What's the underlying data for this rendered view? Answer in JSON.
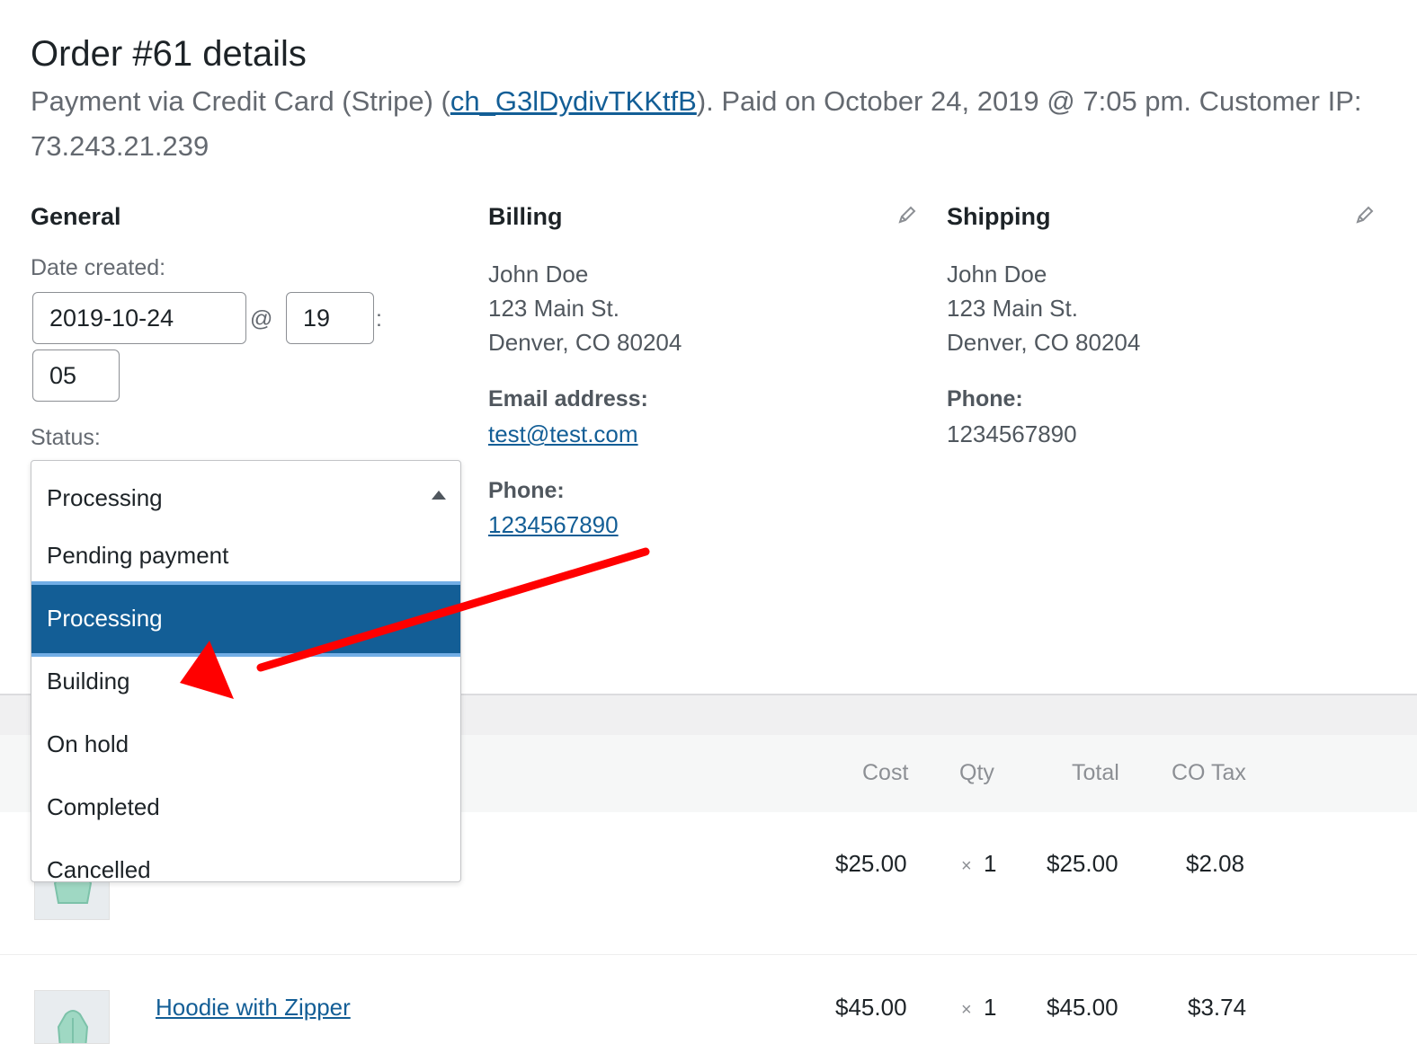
{
  "header": {
    "title": "Order #61 details",
    "meta_prefix": "Payment via Credit Card (Stripe) (",
    "charge_id": "ch_G3lDydivTKKtfB",
    "meta_suffix": "). Paid on October 24, 2019 @ 7:05 pm. Customer IP: 73.243.21.239"
  },
  "general": {
    "heading": "General",
    "date_label": "Date created:",
    "date_value": "2019-10-24",
    "at_sep": "@",
    "hour_value": "19",
    "colon_sep": ":",
    "minute_value": "05",
    "status_label": "Status:",
    "status_selected": "Processing",
    "status_options": [
      "Pending payment",
      "Processing",
      "Building",
      "On hold",
      "Completed",
      "Cancelled"
    ]
  },
  "billing": {
    "heading": "Billing",
    "name": "John Doe",
    "street": "123 Main St.",
    "city": "Denver, CO 80204",
    "email_label": "Email address:",
    "email": "test@test.com",
    "phone_label": "Phone:",
    "phone": "1234567890",
    "edit_icon": "pencil-icon"
  },
  "shipping": {
    "heading": "Shipping",
    "name": "John Doe",
    "street": "123 Main St.",
    "city": "Denver, CO 80204",
    "phone_label": "Phone:",
    "phone": "1234567890",
    "edit_icon": "pencil-icon"
  },
  "items": {
    "columns": [
      "Cost",
      "Qty",
      "Total",
      "CO Tax"
    ],
    "qty_prefix": "×",
    "rows": [
      {
        "name": "",
        "cost": "$25.00",
        "qty": "1",
        "total": "$25.00",
        "tax": "$2.08"
      },
      {
        "name": "Hoodie with Zipper",
        "cost": "$45.00",
        "qty": "1",
        "total": "$45.00",
        "tax": "$3.74"
      }
    ]
  },
  "colors": {
    "link": "#135e96",
    "highlight": "#135e96",
    "annotation_arrow": "#ff0000"
  }
}
